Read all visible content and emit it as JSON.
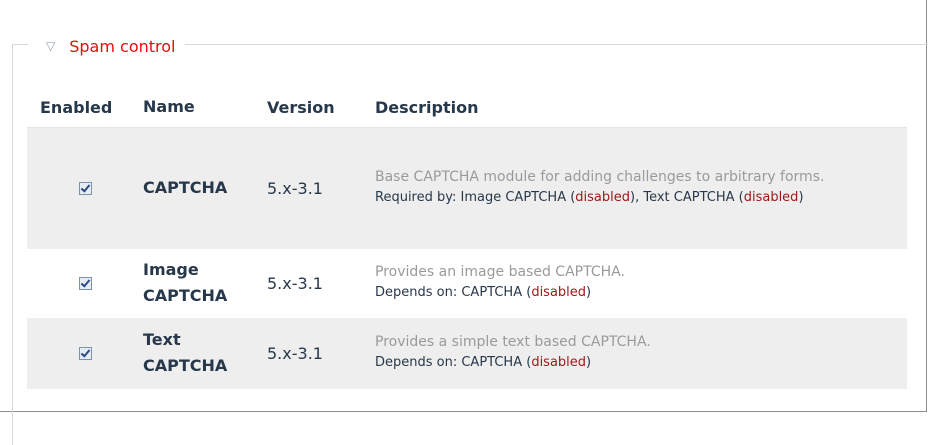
{
  "fieldset": {
    "legend": "Spam control",
    "toggle_icon": "collapse-triangle-icon"
  },
  "table": {
    "headers": {
      "enabled": "Enabled",
      "name": "Name",
      "version": "Version",
      "description": "Description"
    },
    "rows": [
      {
        "enabled": true,
        "name": "CAPTCHA",
        "version": "5.x-3.1",
        "description": "Base CAPTCHA module for adding challenges to arbitrary forms.",
        "relation_prefix": "Required by: Image CAPTCHA (",
        "relation_status_1": "disabled",
        "relation_mid": "), Text CAPTCHA (",
        "relation_status_2": "disabled",
        "relation_suffix": ")"
      },
      {
        "enabled": true,
        "name_line1": "Image",
        "name_line2": "CAPTCHA",
        "version": "5.x-3.1",
        "description": "Provides an image based CAPTCHA.",
        "relation_prefix": "Depends on: CAPTCHA (",
        "relation_status": "disabled",
        "relation_suffix": ")"
      },
      {
        "enabled": true,
        "name_line1": "Text",
        "name_line2": "CAPTCHA",
        "version": "5.x-3.1",
        "description": "Provides a simple text based CAPTCHA.",
        "relation_prefix": "Depends on: CAPTCHA (",
        "relation_status": "disabled",
        "relation_suffix": ")"
      }
    ]
  },
  "colors": {
    "legend": "#e30d0d",
    "disabled": "#a01818",
    "header": "#27384a",
    "row_odd": "#eeeeee"
  }
}
